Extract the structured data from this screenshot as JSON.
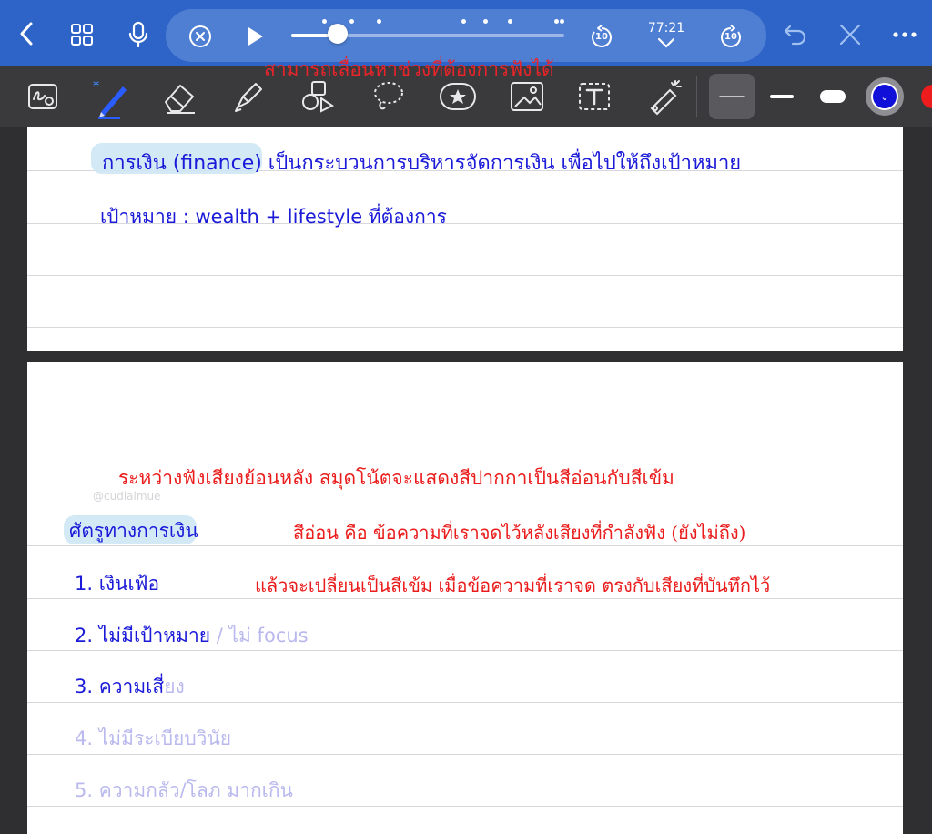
{
  "topbar": {
    "time": "77:21",
    "progress": 0.17,
    "marks_left": [
      0.12,
      0.22,
      0.32
    ],
    "marks_right": [
      0.63,
      0.71,
      0.8,
      0.97,
      0.99
    ],
    "skip_back_label": "10",
    "skip_forward_label": "10",
    "hint": "สามารถเลื่อนหาช่วงที่ต้องการฟังได้"
  },
  "colors": {
    "bar": "#2e64c8",
    "selected_color": "#1010d8",
    "next_color": "#ee1c1c"
  },
  "page1": {
    "line1_term": "การเงิน (finance)",
    "line1_rest": " เป็นกระบวนการบริหารจัดการเงิน เพื่อไปให้ถึงเป้าหมาย",
    "line2": "เป้าหมาย : wealth + lifestyle ที่ต้องการ"
  },
  "page2": {
    "watermark": "@cudlaimue",
    "note_line1": "ระหว่างฟังเสียงย้อนหลัง สมุดโน้ตจะแสดงสีปากกาเป็นสีอ่อนกับสีเข้ม",
    "note_line2": "สีอ่อน คือ ข้อความที่เราจดไว้หลังเสียงที่กำลังฟัง (ยังไม่ถึง)",
    "note_line3": "แล้วจะเปลี่ยนเป็นสีเข้ม เมื่อข้อความที่เราจด ตรงกับเสียงที่บันทึกไว้",
    "heading": "ศัตรูทางการเงิน",
    "item1": "1. เงินเฟ้อ",
    "item2_dark": "2. ไม่มีเป้าหมาย",
    "item2_faint": " / ไม่ focus",
    "item3_dark": "3. ความเสี่",
    "item3_faint": "ยง",
    "item4": "4. ไม่มีระเบียบวินัย",
    "item5": "5. ความกลัว/โลภ มากเกิน"
  }
}
